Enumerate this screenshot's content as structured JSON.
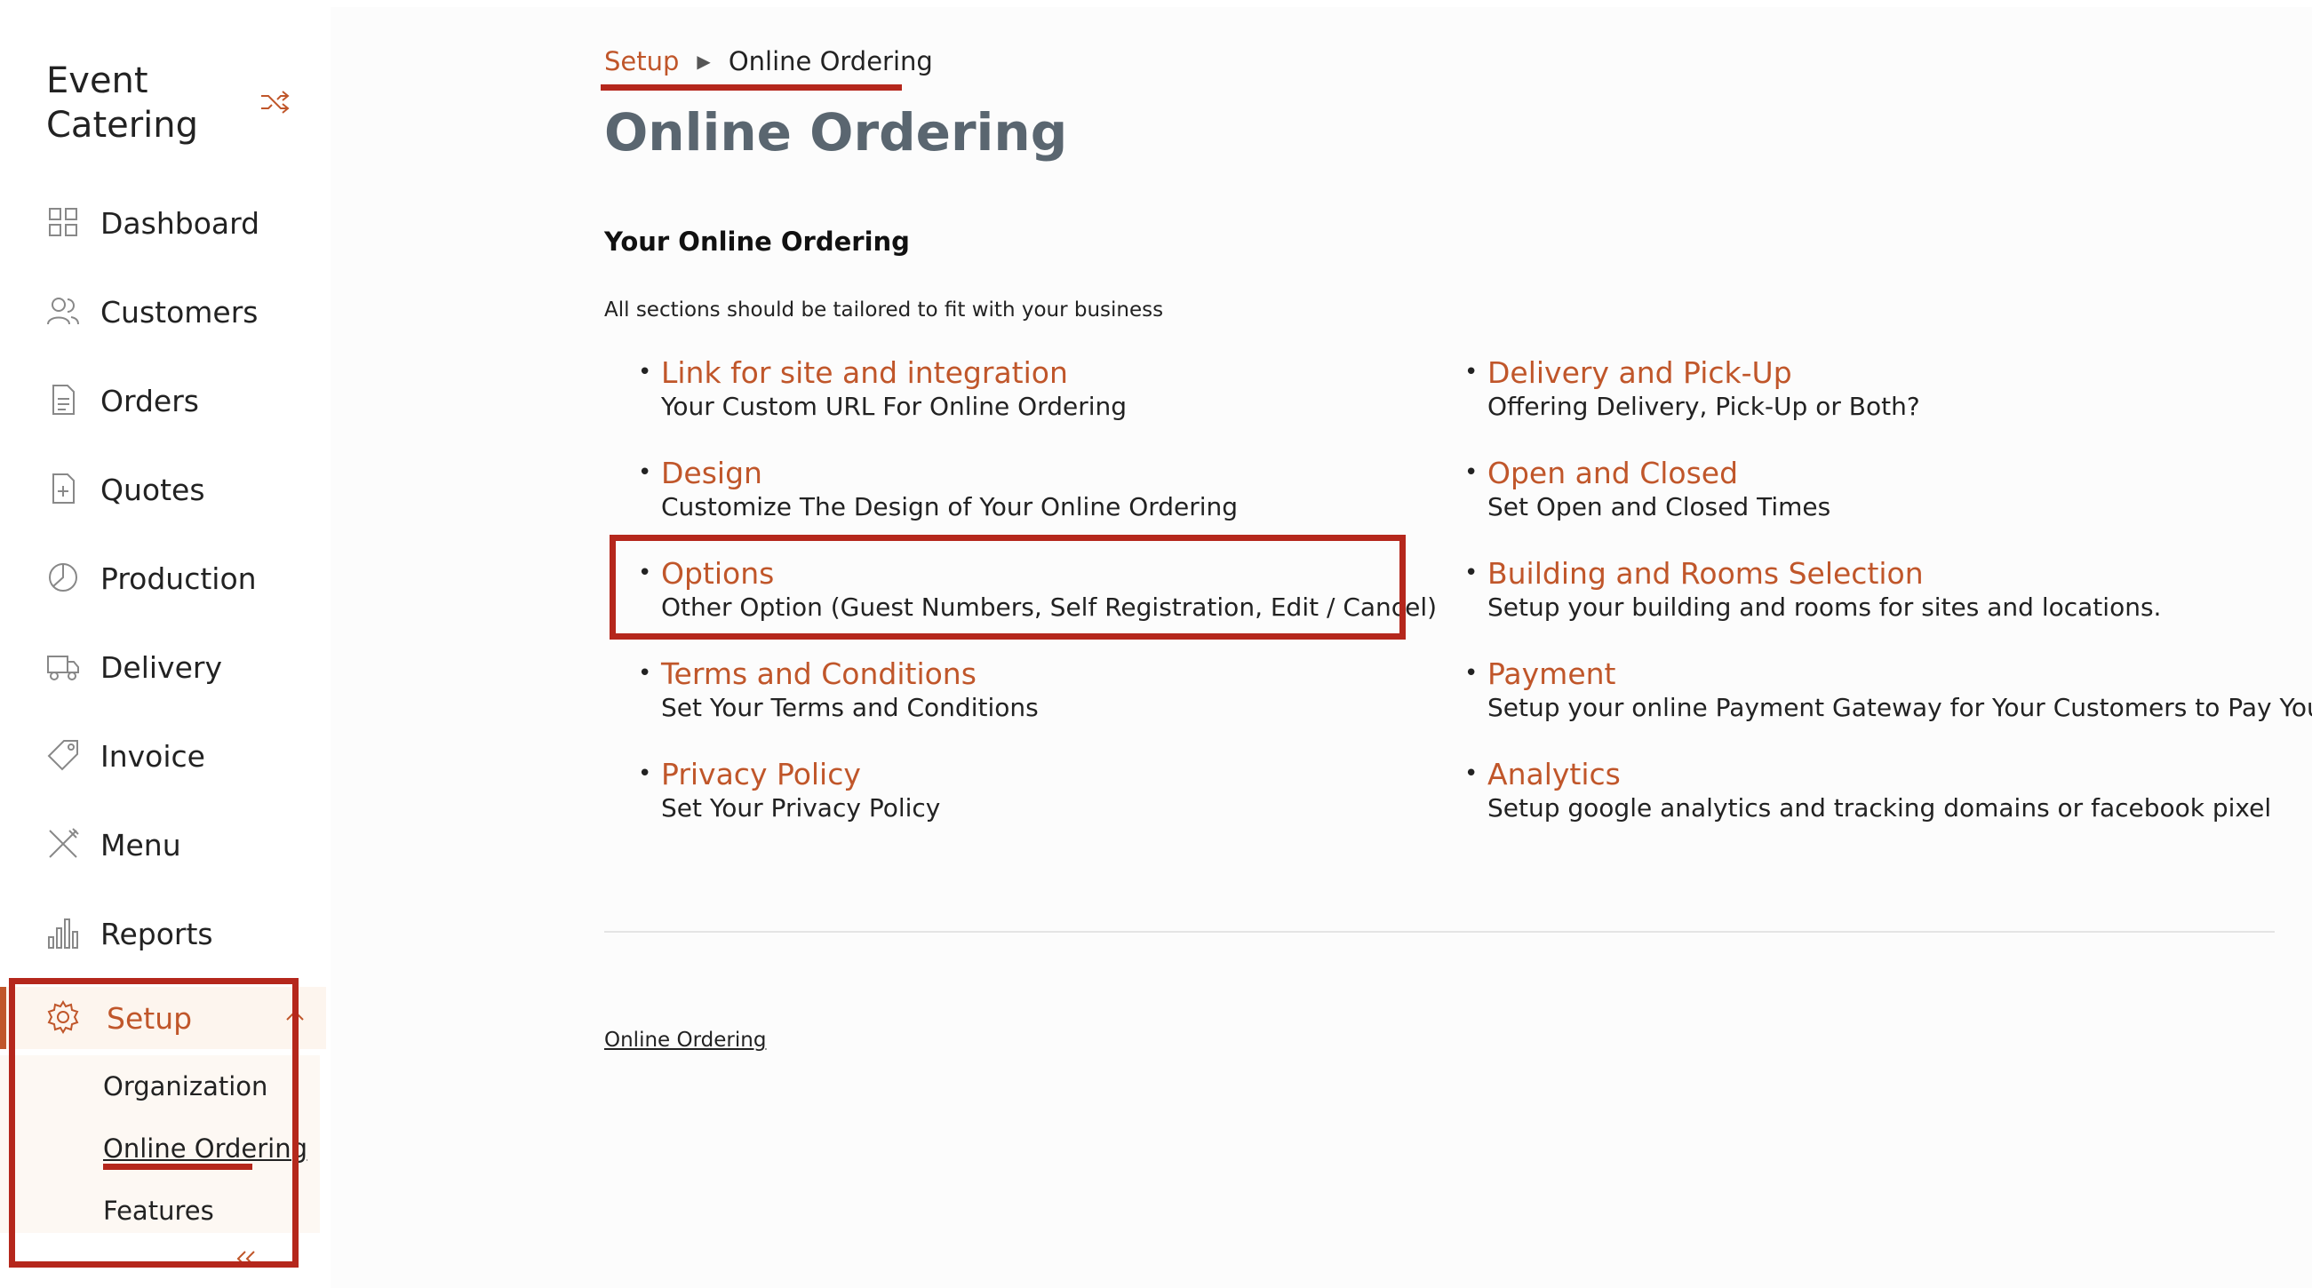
{
  "app": {
    "brand_line1": "Event",
    "brand_line2": "Catering"
  },
  "sidebar": {
    "items": [
      {
        "label": "Dashboard",
        "icon": "grid-icon"
      },
      {
        "label": "Customers",
        "icon": "users-icon"
      },
      {
        "label": "Orders",
        "icon": "document-icon"
      },
      {
        "label": "Quotes",
        "icon": "document-plus-icon"
      },
      {
        "label": "Production",
        "icon": "pie-icon"
      },
      {
        "label": "Delivery",
        "icon": "truck-icon"
      },
      {
        "label": "Invoice",
        "icon": "tag-icon"
      },
      {
        "label": "Menu",
        "icon": "utensils-icon"
      },
      {
        "label": "Reports",
        "icon": "bar-chart-icon"
      },
      {
        "label": "Setup",
        "icon": "gear-icon"
      }
    ],
    "submenu": [
      "Organization",
      "Online Ordering",
      "Features"
    ]
  },
  "breadcrumb": {
    "parent": "Setup",
    "current": "Online Ordering"
  },
  "page": {
    "title": "Online Ordering",
    "section_title": "Your Online Ordering",
    "section_desc": "All sections should be tailored to fit with your business",
    "footer_link": "Online Ordering"
  },
  "options_left": [
    {
      "link": "Link for site and integration",
      "desc": "Your Custom URL For Online Ordering"
    },
    {
      "link": "Design",
      "desc": "Customize The Design of Your Online Ordering"
    },
    {
      "link": "Options",
      "desc": "Other Option (Guest Numbers, Self Registration, Edit / Cancel)"
    },
    {
      "link": "Terms and Conditions",
      "desc": "Set Your Terms and Conditions"
    },
    {
      "link": "Privacy Policy",
      "desc": "Set Your Privacy Policy"
    }
  ],
  "options_right": [
    {
      "link": "Delivery and Pick-Up",
      "desc": "Offering Delivery, Pick-Up or Both?"
    },
    {
      "link": "Open and Closed",
      "desc": "Set Open and Closed Times"
    },
    {
      "link": "Building and Rooms Selection",
      "desc": "Setup your building and rooms for sites and locations."
    },
    {
      "link": "Payment",
      "desc": "Setup your online Payment Gateway for Your Customers to Pay You"
    },
    {
      "link": "Analytics",
      "desc": "Setup google analytics and tracking domains or facebook pixel"
    }
  ],
  "colors": {
    "accent": "#c0562a",
    "highlight": "#b5271c",
    "title": "#5a6670"
  }
}
